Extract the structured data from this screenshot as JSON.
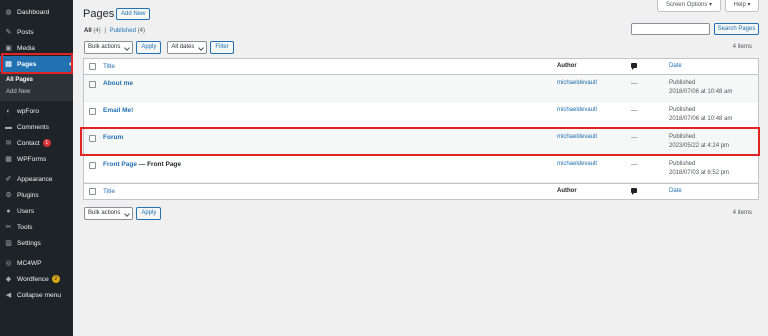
{
  "sidebar": {
    "items": [
      {
        "label": "Dashboard",
        "icon": "dashboard-icon",
        "glyph": "◍"
      },
      {
        "label": "Posts",
        "icon": "pushpin-icon",
        "glyph": "✎"
      },
      {
        "label": "Media",
        "icon": "media-icon",
        "glyph": "▣"
      },
      {
        "label": "Pages",
        "icon": "pages-icon",
        "glyph": "▤"
      },
      {
        "label": "wpForo",
        "icon": "wpforo-icon",
        "glyph": "◐"
      },
      {
        "label": "Comments",
        "icon": "comments-icon",
        "glyph": "▬"
      },
      {
        "label": "Contact",
        "icon": "mail-icon",
        "glyph": "✉",
        "badge": "1"
      },
      {
        "label": "WPForms",
        "icon": "wpforms-icon",
        "glyph": "▦"
      },
      {
        "label": "Appearance",
        "icon": "appearance-icon",
        "glyph": "✐"
      },
      {
        "label": "Plugins",
        "icon": "plugins-icon",
        "glyph": "⚙"
      },
      {
        "label": "Users",
        "icon": "users-icon",
        "glyph": "●"
      },
      {
        "label": "Tools",
        "icon": "tools-icon",
        "glyph": "✂"
      },
      {
        "label": "Settings",
        "icon": "settings-icon",
        "glyph": "▥"
      },
      {
        "label": "MC4WP",
        "icon": "mc4wp-icon",
        "glyph": "◎"
      },
      {
        "label": "Wordfence",
        "icon": "wordfence-icon",
        "glyph": "◆",
        "badge": "2"
      },
      {
        "label": "Collapse menu",
        "icon": "collapse-icon",
        "glyph": "◀"
      }
    ],
    "submenu": [
      "All Pages",
      "Add New"
    ]
  },
  "header": {
    "screen_options": "Screen Options ▾",
    "help": "Help ▾",
    "title": "Pages",
    "add_new": "Add New"
  },
  "filters": {
    "all": "All",
    "all_count": "(4)",
    "sep": "|",
    "published": "Published",
    "published_count": "(4)"
  },
  "search": {
    "button": "Search Pages",
    "value": ""
  },
  "tablenav_top": {
    "bulk": "Bulk actions",
    "apply": "Apply",
    "dates": "All dates",
    "filter": "Filter",
    "count": "4 items"
  },
  "tablenav_bottom": {
    "bulk": "Bulk actions",
    "apply": "Apply",
    "count": "4 items"
  },
  "table": {
    "columns": {
      "title": "Title",
      "author": "Author",
      "date": "Date"
    },
    "rows": [
      {
        "title": "About me",
        "state": "",
        "author": "michaeldevault",
        "comments": "—",
        "status": "Published",
        "date": "2018/07/06 at 10:48 am"
      },
      {
        "title": "Email Me!",
        "state": "",
        "author": "michaeldevault",
        "comments": "—",
        "status": "Published",
        "date": "2018/07/06 at 10:48 am"
      },
      {
        "title": "Forum",
        "state": "",
        "author": "michaeldevault",
        "comments": "—",
        "status": "Published",
        "date": "2023/05/22 at 4:24 pm"
      },
      {
        "title": "Front Page",
        "state": "— Front Page",
        "author": "michaeldevault",
        "comments": "—",
        "status": "Published",
        "date": "2018/07/03 at 6:52 pm"
      }
    ]
  },
  "colors": {
    "accent": "#2271b1",
    "highlight": "#e02424",
    "sidebar": "#1d2327"
  }
}
